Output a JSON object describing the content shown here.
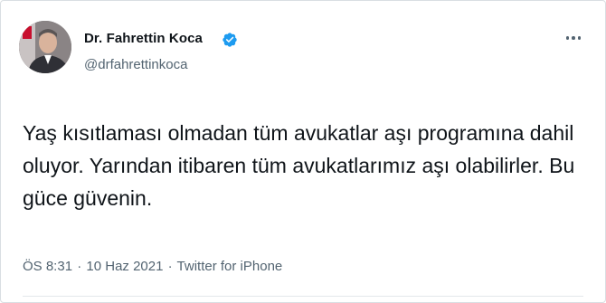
{
  "user": {
    "name": "Dr. Fahrettin Koca",
    "handle": "@drfahrettinkoca",
    "avatar_icon": "profile-photo",
    "verified_icon": "verified-badge-icon"
  },
  "tweet": {
    "text": "Yaş kısıtlaması olmadan tüm avukatlar aşı programına dahil oluyor. Yarından itibaren tüm avukatlarımız aşı olabilirler. Bu güce güvenin.",
    "time": "ÖS 8:31",
    "separator": "·",
    "date": "10 Haz 2021",
    "source": "Twitter for iPhone"
  },
  "colors": {
    "verified": "#1d9bf0",
    "text": "#0f1419",
    "secondary": "#536471"
  }
}
